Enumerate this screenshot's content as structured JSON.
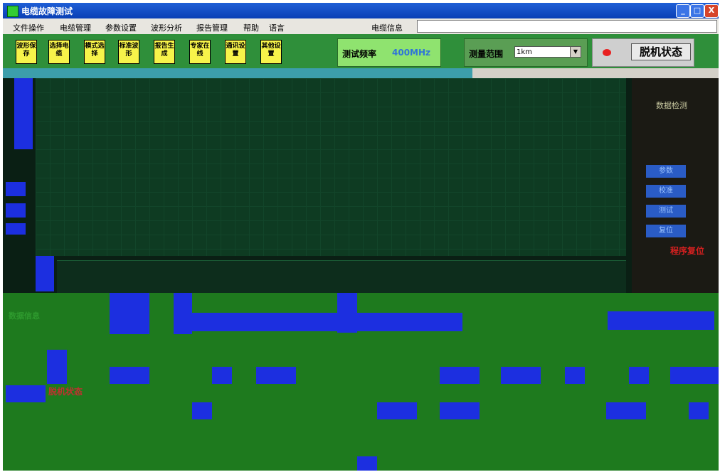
{
  "window": {
    "title": "电缆故障测试",
    "controls": {
      "minimize": "_",
      "maximize": "□",
      "close": "X"
    }
  },
  "menu": {
    "items": [
      "文件操作",
      "电缆管理",
      "参数设置",
      "波形分析",
      "报告管理",
      "帮助",
      "语言"
    ],
    "cable_info_label": "电缆信息",
    "cable_info_value": ""
  },
  "toolbar": {
    "buttons": [
      "波形保存",
      "选择电缆",
      "模式选择",
      "标准波形",
      "报告生成",
      "专家在线",
      "通讯设置",
      "其他设置"
    ],
    "freq_label": "测试频率",
    "freq_value": "400MHz",
    "range_label": "测量范围",
    "range_value": "1km",
    "status_text": "脱机状态"
  },
  "right_panel": {
    "title": "数据检测",
    "buttons": [
      "参数",
      "校准",
      "测试",
      "复位"
    ],
    "red_text": "程序复位"
  },
  "bottom": {
    "offline_label": "脱机状态",
    "left_label": "数据信息"
  },
  "colors": {
    "title_bar": "#0a3fb5",
    "toolbar_bg": "#2f8f3a",
    "tool_button": "#f7f34a",
    "freq_value": "#2f74d8",
    "status_led": "#e82020",
    "waveform_bg": "#0e3b22",
    "bottom_bg": "#1e7a1e",
    "blue_block": "#1c2fe0"
  }
}
